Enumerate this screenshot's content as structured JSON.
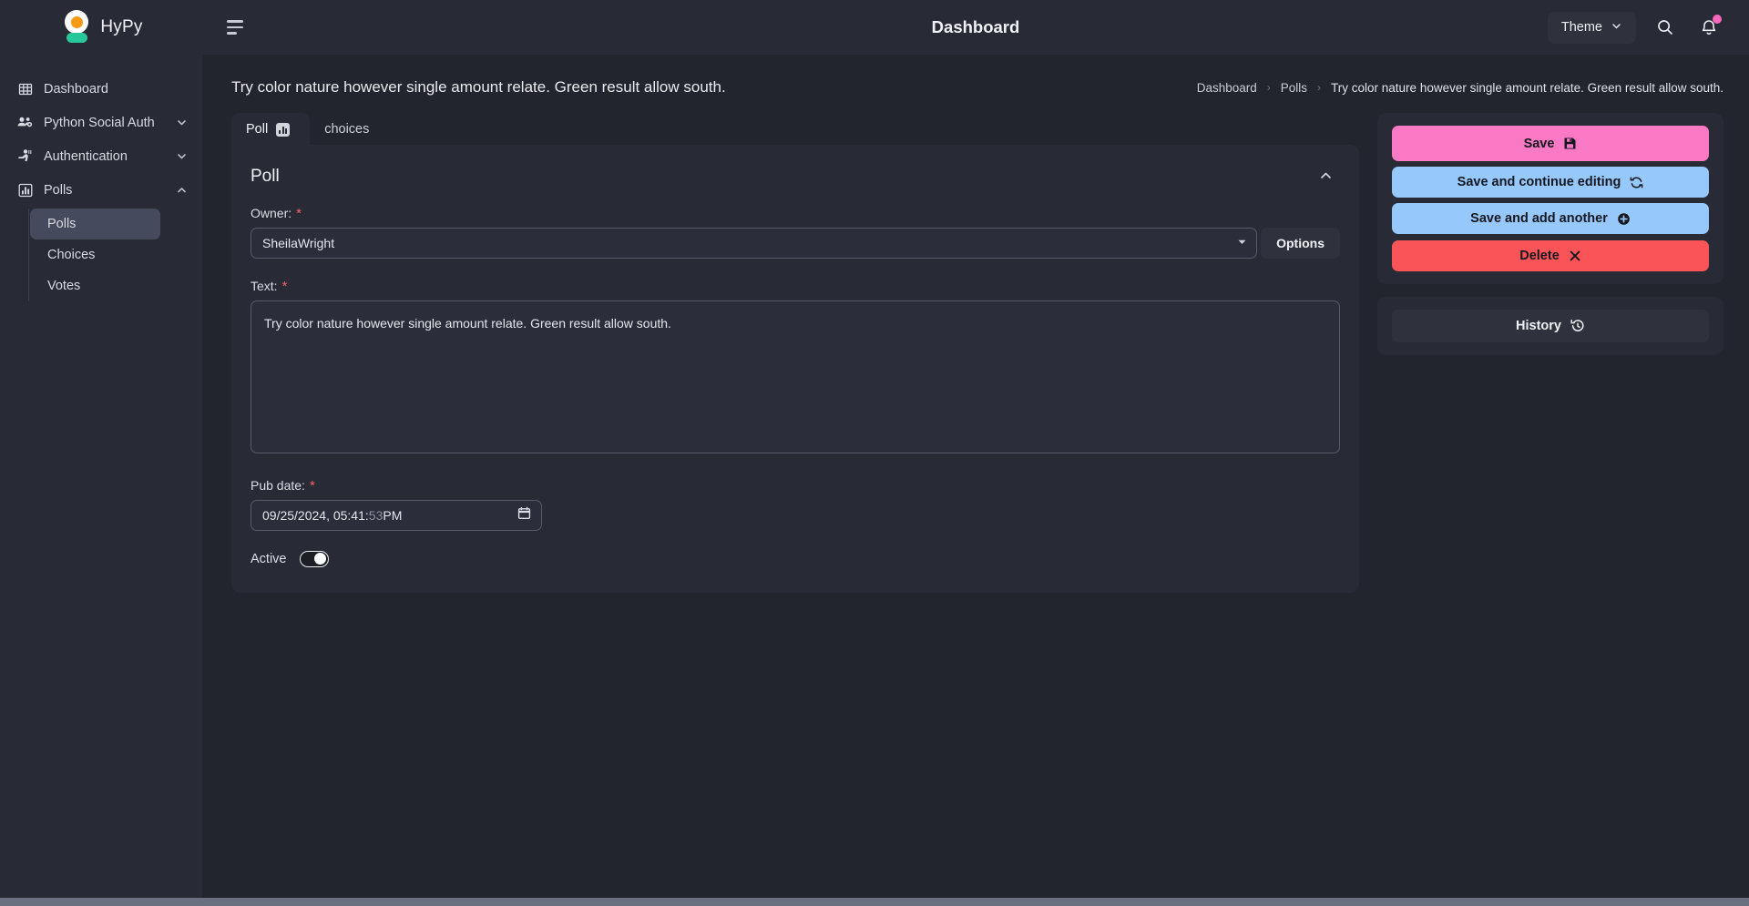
{
  "brand": {
    "name": "HyPy"
  },
  "sidebar": {
    "items": [
      {
        "label": "Dashboard",
        "icon": "grid-icon",
        "expandable": false
      },
      {
        "label": "Python Social Auth",
        "icon": "users-gear-icon",
        "expandable": true
      },
      {
        "label": "Authentication",
        "icon": "person-key-icon",
        "expandable": true
      },
      {
        "label": "Polls",
        "icon": "bar-chart-icon",
        "expandable": true,
        "expanded": true
      }
    ],
    "sub_items": [
      {
        "label": "Polls",
        "active": true
      },
      {
        "label": "Choices",
        "active": false
      },
      {
        "label": "Votes",
        "active": false
      }
    ]
  },
  "topbar": {
    "title": "Dashboard",
    "theme_label": "Theme",
    "menu_icon": "hamburger-icon",
    "search_icon": "search-icon",
    "bell_icon": "bell-icon",
    "has_notification": true
  },
  "page": {
    "title": "Try color nature however single amount relate. Green result allow south.",
    "breadcrumb": [
      {
        "label": "Dashboard",
        "link": true
      },
      {
        "label": "Polls",
        "link": true
      },
      {
        "label": "Try color nature however single amount relate. Green result allow south.",
        "link": false
      }
    ],
    "breadcrumb_separator": "›"
  },
  "tabs": [
    {
      "label": "Poll",
      "active": true,
      "icon": "bar-chart-icon"
    },
    {
      "label": "choices",
      "active": false,
      "icon": null
    }
  ],
  "card": {
    "title": "Poll",
    "collapse_icon": "chevron-up-icon",
    "fields": {
      "owner": {
        "label": "Owner:",
        "required": true,
        "value": "SheilaWright",
        "options_button": "Options"
      },
      "text": {
        "label": "Text:",
        "required": true,
        "value": "Try color nature however single amount relate. Green result allow south."
      },
      "pub_date": {
        "label": "Pub date:",
        "required": true,
        "value_main": "09/25/2024, 05:41:",
        "value_seconds": "53",
        "value_ampm": " PM",
        "full_value": "09/25/2024, 05:41:53 PM"
      },
      "active": {
        "label": "Active",
        "checked": true
      }
    },
    "required_marker": "*"
  },
  "actions": {
    "save": {
      "label": "Save",
      "icon": "floppy-disk-icon",
      "color": "#fa79c5"
    },
    "save_continue": {
      "label": "Save and continue editing",
      "icon": "refresh-icon",
      "color": "#96c8fc"
    },
    "save_add_another": {
      "label": "Save and add another",
      "icon": "plus-circle-icon",
      "color": "#96c8fc"
    },
    "delete": {
      "label": "Delete",
      "icon": "x-icon",
      "color": "#fb5458"
    },
    "history": {
      "label": "History",
      "icon": "history-icon"
    }
  },
  "colors": {
    "page_bg": "#22242e",
    "panel_bg": "#282b36",
    "accent_pink": "#fa79c5",
    "accent_blue": "#96c8fc",
    "accent_red": "#fb5458",
    "brand_orange": "#f79a16",
    "brand_green": "#27c79a",
    "required_red": "#f4626c"
  }
}
